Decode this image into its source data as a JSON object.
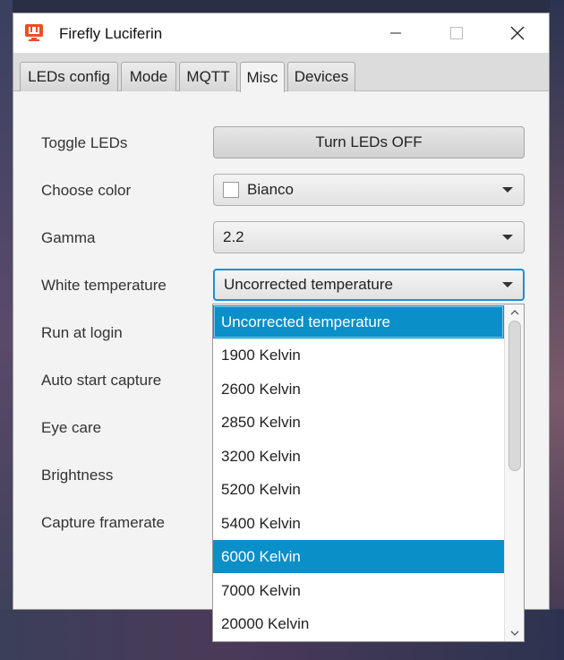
{
  "window": {
    "title": "Firefly Luciferin",
    "icon": "firefly-app-icon",
    "accent_color": "#e8501f"
  },
  "tabs": [
    {
      "label": "LEDs config",
      "active": false
    },
    {
      "label": "Mode",
      "active": false
    },
    {
      "label": "MQTT",
      "active": false
    },
    {
      "label": "Misc",
      "active": true
    },
    {
      "label": "Devices",
      "active": false
    }
  ],
  "rows": {
    "toggle_leds": {
      "label": "Toggle LEDs",
      "button": "Turn LEDs OFF"
    },
    "choose_color": {
      "label": "Choose color",
      "value": "Bianco",
      "swatch": "#ffffff"
    },
    "gamma": {
      "label": "Gamma",
      "value": "2.2"
    },
    "white_temperature": {
      "label": "White temperature",
      "value": "Uncorrected temperature"
    },
    "run_at_login": {
      "label": "Run at login"
    },
    "auto_start_capture": {
      "label": "Auto start capture"
    },
    "eye_care": {
      "label": "Eye care"
    },
    "brightness": {
      "label": "Brightness"
    },
    "capture_framerate": {
      "label": "Capture framerate"
    }
  },
  "dropdown": {
    "items": [
      "Uncorrected temperature",
      "1900 Kelvin",
      "2600 Kelvin",
      "2850 Kelvin",
      "3200 Kelvin",
      "5200 Kelvin",
      "5400 Kelvin",
      "6000 Kelvin",
      "7000 Kelvin",
      "20000 Kelvin"
    ],
    "focused": "Uncorrected temperature",
    "hovered": "6000 Kelvin",
    "highlight_color": "#0a8fc8"
  }
}
